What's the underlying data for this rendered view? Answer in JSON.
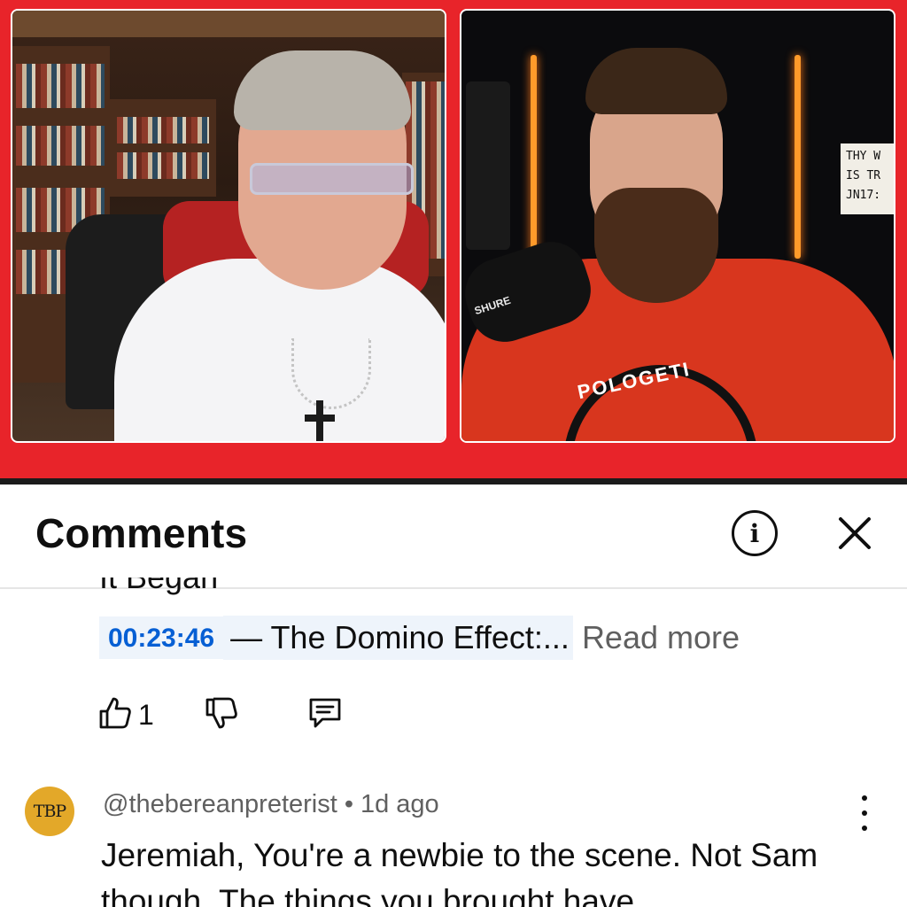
{
  "video": {
    "sign_lines": [
      "THY W",
      "IS TR",
      "JN17:"
    ],
    "mic_brand": "SHURE",
    "shirt_text": "POLOGETI"
  },
  "comments_panel": {
    "title": "Comments",
    "info_icon": "info-icon",
    "close_icon": "close-icon",
    "previous_comment": {
      "cut_off_text": "It Began",
      "timestamp": "00:23:46",
      "text": "— The Domino Effect:...",
      "read_more": "Read more",
      "like_count": "1",
      "icons": [
        "thumbs-up-icon",
        "thumbs-down-icon",
        "reply-icon"
      ]
    },
    "comment": {
      "avatar_text": "TBP",
      "avatar_color": "#e3a829",
      "author": "@thebereanpreterist",
      "separator": "•",
      "age": "1d ago",
      "text": "Jeremiah, You're a newbie to the scene. Not Sam though. The things you brought have"
    }
  },
  "colors": {
    "video_border": "#e8242a",
    "link_blue": "#065fd4",
    "secondary_text": "#606060"
  }
}
